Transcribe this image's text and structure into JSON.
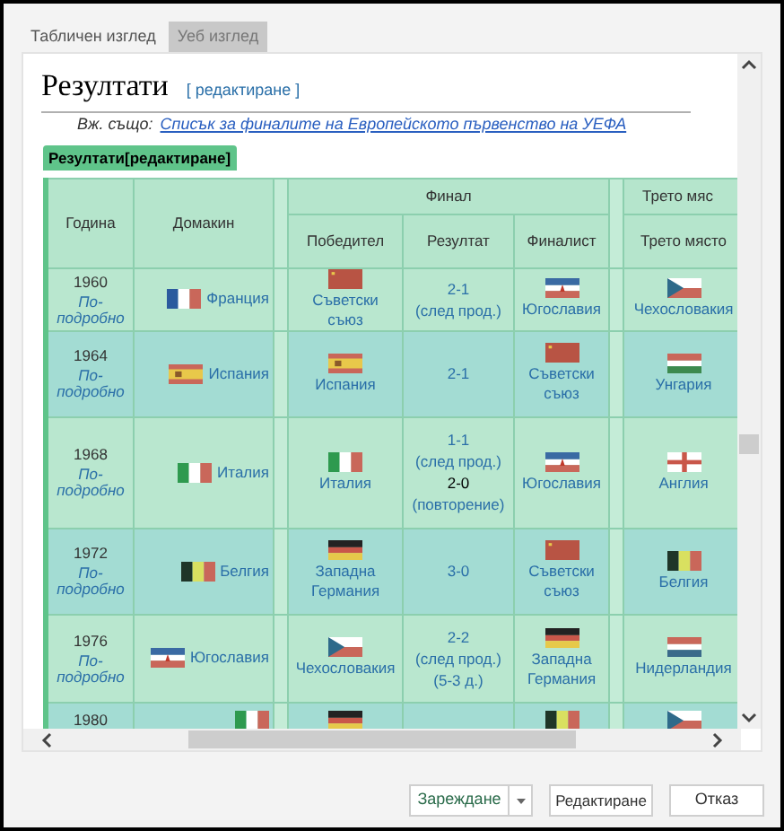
{
  "tabs": [
    {
      "label": "Табличен изглед",
      "selected": false
    },
    {
      "label": "Уеб изглед",
      "selected": true
    }
  ],
  "page": {
    "heading": "Резултати",
    "edit_link": "[ редактиране ]",
    "see_also_label": "Вж. също:",
    "see_also_link": "Списък за финалите на Европейското първенство на УЕФА",
    "table_caption": "Резултати[редактиране]"
  },
  "table": {
    "headers": {
      "year": "Година",
      "host": "Домакин",
      "final": "Финал",
      "winner": "Победител",
      "score": "Резултат",
      "finalist": "Финалист",
      "third_group": "Трето мяс",
      "third": "Трето място"
    },
    "rows": [
      {
        "year": "1960",
        "details": "По-подробно",
        "host": {
          "kind": "france",
          "name": "Франция"
        },
        "winner": {
          "kind": "ussr",
          "name": "Съветски съюз"
        },
        "score": [
          {
            "text": "2-1",
            "link": true
          },
          {
            "text": "(след прод.)",
            "link": true
          }
        ],
        "finalist": {
          "kind": "yugoslavia",
          "name": "Югославия"
        },
        "third": {
          "kind": "czech",
          "name": "Чехословакия"
        }
      },
      {
        "year": "1964",
        "details": "По-подробно",
        "host": {
          "kind": "spain",
          "name": "Испания"
        },
        "winner": {
          "kind": "spain",
          "name": "Испания"
        },
        "score": [
          {
            "text": "2-1",
            "link": true
          }
        ],
        "finalist": {
          "kind": "ussr",
          "name": "Съветски съюз"
        },
        "third": {
          "kind": "hungary",
          "name": "Унгария"
        }
      },
      {
        "year": "1968",
        "details": "По-подробно",
        "host": {
          "kind": "italy",
          "name": "Италия"
        },
        "winner": {
          "kind": "italy",
          "name": "Италия"
        },
        "score": [
          {
            "text": "1-1",
            "link": true
          },
          {
            "text": "(след прод.)",
            "link": true
          },
          {
            "text": "2-0",
            "link": false
          },
          {
            "text": "(повторение)",
            "link": true
          }
        ],
        "finalist": {
          "kind": "yugoslavia",
          "name": "Югославия"
        },
        "third": {
          "kind": "england",
          "name": "Англия"
        }
      },
      {
        "year": "1972",
        "details": "По-подробно",
        "host": {
          "kind": "belgium",
          "name": "Белгия"
        },
        "winner": {
          "kind": "germany",
          "name": "Западна Германия"
        },
        "score": [
          {
            "text": "3-0",
            "link": true
          }
        ],
        "finalist": {
          "kind": "ussr",
          "name": "Съветски съюз"
        },
        "third": {
          "kind": "belgium",
          "name": "Белгия"
        }
      },
      {
        "year": "1976",
        "details": "По-подробно",
        "host": {
          "kind": "yugoslavia",
          "name": "Югославия"
        },
        "winner": {
          "kind": "czech",
          "name": "Чехословакия"
        },
        "score": [
          {
            "text": "2-2",
            "link": true
          },
          {
            "text": "(след прод.)",
            "link": true
          },
          {
            "text": "(5-3 д.)",
            "link": true
          }
        ],
        "finalist": {
          "kind": "germany",
          "name": "Западна Германия"
        },
        "third": {
          "kind": "netherlands",
          "name": "Нидерландия"
        }
      },
      {
        "year": "1980",
        "host": {
          "kind": "italy"
        },
        "winner": {
          "kind": "germany"
        },
        "finalist": {
          "kind": "belgium"
        },
        "third": {
          "kind": "czech"
        }
      }
    ]
  },
  "buttons": {
    "load": "Зареждане",
    "edit": "Редактиране",
    "cancel": "Отказ"
  }
}
